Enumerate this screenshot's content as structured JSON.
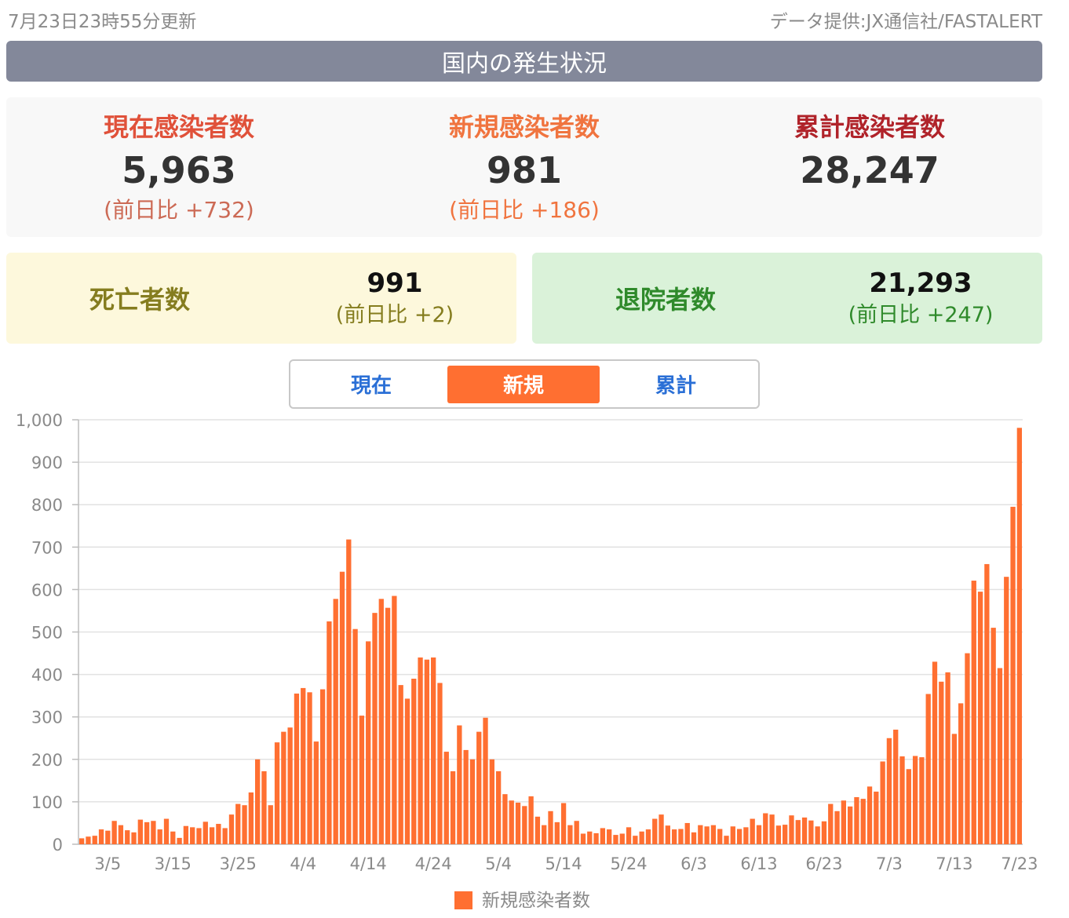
{
  "header": {
    "updated": "7月23日23時55分更新",
    "source": "データ提供:JX通信社/FASTALERT",
    "banner": "国内の発生状況"
  },
  "summary": {
    "current": {
      "label": "現在感染者数",
      "value": "5,963",
      "diff": "(前日比 +732)",
      "color": "#e0513a"
    },
    "new": {
      "label": "新規感染者数",
      "value": "981",
      "diff": "(前日比 +186)",
      "color": "#f0743f"
    },
    "total": {
      "label": "累計感染者数",
      "value": "28,247",
      "color": "#b0232a"
    }
  },
  "deaths": {
    "label": "死亡者数",
    "value": "991",
    "diff": "(前日比 +2)",
    "color": "#857d1f"
  },
  "recovered": {
    "label": "退院者数",
    "value": "21,293",
    "diff": "(前日比 +247)",
    "color": "#2f8a2b"
  },
  "tabs": [
    {
      "label": "現在",
      "active": false
    },
    {
      "label": "新規",
      "active": true
    },
    {
      "label": "累計",
      "active": false
    }
  ],
  "chart_data": {
    "type": "bar",
    "start_date": "2020-03-01",
    "end_date": "2020-07-23",
    "x_tick_labels": [
      "3/5",
      "3/15",
      "3/25",
      "4/4",
      "4/14",
      "4/24",
      "5/4",
      "5/14",
      "5/24",
      "6/3",
      "6/13",
      "6/23",
      "7/3",
      "7/13",
      "7/23"
    ],
    "y_tick_labels": [
      "0",
      "100",
      "200",
      "300",
      "400",
      "500",
      "600",
      "700",
      "800",
      "900",
      "1,000"
    ],
    "ylim": [
      0,
      1000
    ],
    "grid": true,
    "bar_color": "#ff6f31",
    "legend_position": "bottom",
    "series": [
      {
        "name": "新規感染者数",
        "values": [
          14,
          18,
          20,
          35,
          32,
          55,
          45,
          33,
          28,
          58,
          52,
          55,
          35,
          60,
          30,
          15,
          43,
          40,
          38,
          53,
          40,
          48,
          38,
          70,
          95,
          92,
          122,
          200,
          172,
          92,
          240,
          265,
          275,
          355,
          368,
          358,
          242,
          365,
          525,
          578,
          642,
          718,
          507,
          303,
          478,
          545,
          578,
          557,
          585,
          375,
          343,
          390,
          440,
          435,
          440,
          380,
          218,
          172,
          280,
          222,
          200,
          265,
          298,
          200,
          172,
          118,
          103,
          98,
          90,
          113,
          65,
          45,
          78,
          52,
          97,
          45,
          55,
          25,
          30,
          26,
          38,
          35,
          22,
          25,
          40,
          20,
          30,
          35,
          60,
          70,
          44,
          35,
          36,
          50,
          28,
          45,
          42,
          45,
          36,
          20,
          42,
          36,
          40,
          60,
          45,
          73,
          70,
          44,
          46,
          68,
          57,
          63,
          56,
          42,
          54,
          95,
          78,
          103,
          89,
          111,
          107,
          136,
          124,
          195,
          250,
          270,
          207,
          177,
          208,
          205,
          354,
          430,
          383,
          405,
          260,
          332,
          450,
          621,
          595,
          660,
          510,
          415,
          630,
          795,
          981
        ]
      }
    ]
  }
}
